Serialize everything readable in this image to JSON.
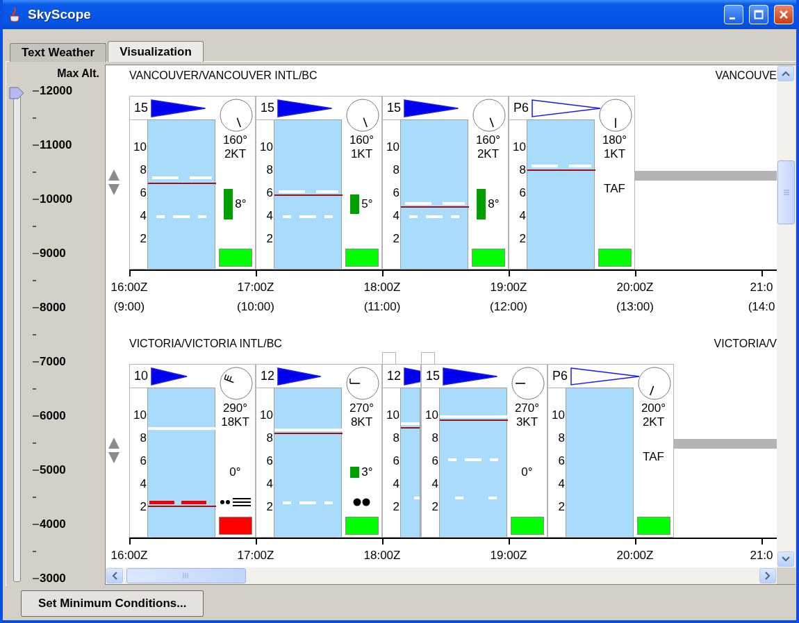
{
  "window": {
    "title": "SkyScope"
  },
  "tabs": [
    {
      "label": "Text Weather",
      "selected": false
    },
    {
      "label": "Visualization",
      "selected": true
    }
  ],
  "altitude_slider": {
    "label": "Max Alt.",
    "level": 1,
    "ticks": [
      "12000",
      "11000",
      "10000",
      "9000",
      "8000",
      "7000",
      "6000",
      "5000",
      "4000",
      "3000"
    ]
  },
  "stations": [
    {
      "title": "VANCOUVER/VANCOUVER INTL/BC",
      "title_right": "VANCOUVE",
      "cards": [
        {
          "kind": "obs",
          "narrow": false,
          "overlapping": false,
          "visibility": "15",
          "axis": [
            "10",
            "8",
            "6",
            "4",
            "2"
          ],
          "layers": [
            {
              "kind": "broken"
            },
            {
              "kind": "ceiling"
            },
            {
              "kind": "scattered"
            }
          ],
          "wind": {
            "direction": "160°",
            "speed": "2KT"
          },
          "temperature": "8°",
          "status": {
            "color": "#00ff00"
          }
        },
        {
          "kind": "obs",
          "narrow": false,
          "overlapping": false,
          "visibility": "15",
          "axis": [
            "10",
            "8",
            "6",
            "4",
            "2"
          ],
          "layers": [
            {
              "kind": "broken"
            },
            {
              "kind": "ceiling"
            },
            {
              "kind": "scattered"
            }
          ],
          "wind": {
            "direction": "160°",
            "speed": "1KT"
          },
          "temperature": "5°",
          "status": {
            "color": "#00ff00"
          }
        },
        {
          "kind": "obs",
          "narrow": false,
          "overlapping": false,
          "visibility": "15",
          "axis": [
            "10",
            "8",
            "6",
            "4",
            "2"
          ],
          "layers": [
            {
              "kind": "broken"
            },
            {
              "kind": "ceiling"
            },
            {
              "kind": "scattered"
            }
          ],
          "wind": {
            "direction": "160°",
            "speed": "2KT"
          },
          "temperature": "8°",
          "status": {
            "color": "#00ff00"
          }
        },
        {
          "kind": "taf",
          "narrow": false,
          "overlapping": false,
          "visibility": "P6",
          "axis": [
            "10",
            "8",
            "6",
            "4",
            "2"
          ],
          "layers": [
            {
              "kind": "broken"
            },
            {
              "kind": "ceiling"
            }
          ],
          "wind": {
            "direction": "180°",
            "speed": "1KT"
          },
          "note": "TAF",
          "status": {
            "color": "#00ff00"
          }
        }
      ],
      "timeline": [
        {
          "utc": "16:00Z",
          "local": "(9:00)"
        },
        {
          "utc": "17:00Z",
          "local": "(10:00)"
        },
        {
          "utc": "18:00Z",
          "local": "(11:00)"
        },
        {
          "utc": "19:00Z",
          "local": "(12:00)"
        },
        {
          "utc": "20:00Z",
          "local": "(13:00)"
        },
        {
          "utc": "21:0",
          "local": "(14:0"
        }
      ]
    },
    {
      "title": "VICTORIA/VICTORIA INTL/BC",
      "title_right": "VICTORIA/V",
      "cards": [
        {
          "kind": "obs",
          "narrow": false,
          "overlapping": false,
          "visibility": "10",
          "axis": [
            "10",
            "8",
            "6",
            "4",
            "2"
          ],
          "layers": [
            {
              "kind": "overcast"
            },
            {
              "kind": "broken-alert"
            },
            {
              "kind": "ceiling"
            }
          ],
          "wind": {
            "direction": "290°",
            "speed": "18KT"
          },
          "temperature": "0°",
          "weather": {
            "kind": "rain-fog"
          },
          "status": {
            "color": "#ff0000"
          }
        },
        {
          "kind": "obs",
          "narrow": false,
          "overlapping": false,
          "visibility": "12",
          "axis": [
            "10",
            "8",
            "6",
            "4",
            "2"
          ],
          "layers": [
            {
              "kind": "overcast"
            },
            {
              "kind": "ceiling"
            },
            {
              "kind": "scattered"
            }
          ],
          "wind": {
            "direction": "270°",
            "speed": "8KT"
          },
          "temperature": "3°",
          "weather": {
            "kind": "rain"
          },
          "status": {
            "color": "#00ff00"
          }
        },
        {
          "kind": "obs",
          "narrow": true,
          "overlapping": true,
          "visibility": "12",
          "axis": [
            "10",
            "8",
            "6",
            "4",
            "2"
          ],
          "layers": [
            {
              "kind": "overcast"
            },
            {
              "kind": "ceiling"
            },
            {
              "kind": "scattered"
            }
          ]
        },
        {
          "kind": "obs",
          "narrow": false,
          "overlapping": true,
          "visibility": "15",
          "axis": [
            "10",
            "8",
            "6",
            "4",
            "2"
          ],
          "layers": [
            {
              "kind": "overcast"
            },
            {
              "kind": "ceiling"
            },
            {
              "kind": "scattered"
            },
            {
              "kind": "few"
            }
          ],
          "wind": {
            "direction": "270°",
            "speed": "3KT"
          },
          "temperature": "0°",
          "status": {
            "color": "#00ff00"
          }
        },
        {
          "kind": "taf",
          "narrow": false,
          "overlapping": false,
          "visibility": "P6",
          "axis": [
            "10",
            "8",
            "6",
            "4",
            "2"
          ],
          "wind": {
            "direction": "200°",
            "speed": "2KT"
          },
          "note": "TAF",
          "status": {
            "color": "#00ff00"
          }
        }
      ],
      "timeline": [
        {
          "utc": "16:00Z"
        },
        {
          "utc": "17:00Z"
        },
        {
          "utc": "18:00Z"
        },
        {
          "utc": "19:00Z"
        },
        {
          "utc": "20:00Z"
        },
        {
          "utc": "21:0"
        }
      ]
    }
  ],
  "button": "Set Minimum Conditions..."
}
